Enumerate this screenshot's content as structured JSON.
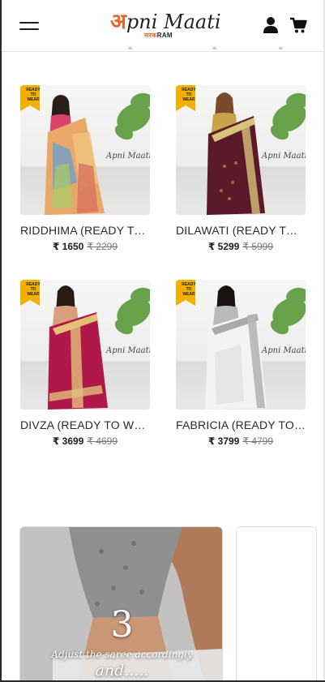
{
  "header": {
    "logo_first_letter": "अ",
    "logo_text": "pni Maati",
    "logo_sub_accent": "सरक",
    "logo_sub": "RAM",
    "menu_icon": "hamburger-menu-icon",
    "user_icon": "user-icon",
    "cart_icon": "cart-icon"
  },
  "brand_colors": {
    "accent": "#e8652a",
    "badge": "#f2b100",
    "text": "#222222"
  },
  "products": [
    {
      "name": "RIDDHIMA (READY TO WEAR)",
      "price": "₹ 1650",
      "mrp": "₹ 2299",
      "badge": "READY TO WEAR",
      "badge_lines": [
        "READY",
        "TO",
        "WEAR"
      ],
      "watermark": "Apni Maati"
    },
    {
      "name": "DILAWATI (READY TO WEAR)",
      "price": "₹ 5299",
      "mrp": "₹ 5999",
      "badge": "READY TO WEAR",
      "badge_lines": [
        "READY",
        "TO",
        "WEAR"
      ],
      "watermark": "Apni Maati"
    },
    {
      "name": "DIVZA (READY TO WEAR)",
      "price": "₹ 3699",
      "mrp": "₹ 4699",
      "badge": "READY TO WEAR",
      "badge_lines": [
        "READY",
        "TO",
        "WEAR"
      ],
      "watermark": "Apni Maati"
    },
    {
      "name": "FABRICIA (READY TO WEAR)",
      "price": "₹ 3799",
      "mrp": "₹ 4799",
      "badge": "READY TO WEAR",
      "badge_lines": [
        "READY",
        "TO",
        "WEAR"
      ],
      "watermark": "Apni Maati"
    }
  ],
  "story": {
    "step": "3",
    "caption": "Adjust the saree accordingly",
    "more": "and....."
  }
}
